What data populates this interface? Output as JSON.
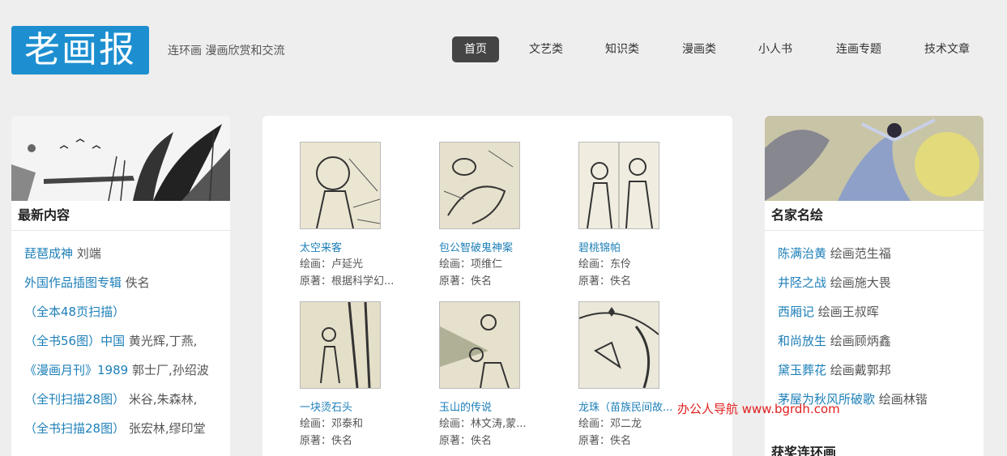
{
  "header": {
    "logo": "老画报",
    "tagline": "连环画 漫画欣赏和交流",
    "nav": [
      "首页",
      "文艺类",
      "知识类",
      "漫画类",
      "小人书",
      "连画专题",
      "技术文章"
    ],
    "active_nav": "首页"
  },
  "left": {
    "title": "最新内容",
    "items": [
      {
        "link": "琵琶成神",
        "text": " 刘端"
      },
      {
        "link": "外国作品插图专辑",
        "text": " 佚名"
      },
      {
        "link": "（全本48页扫描）",
        "text": ""
      },
      {
        "link": "（全书56图）中国",
        "text": " 黄光辉,丁燕,"
      },
      {
        "link": "《漫画月刊》1989",
        "text": " 郭士厂,孙绍波"
      },
      {
        "link": "（全刊扫描28图）",
        "text": " 米谷,朱森林,"
      },
      {
        "link": "（全书扫描28图）",
        "text": " 张宏林,缪印堂"
      }
    ]
  },
  "center": {
    "cards": [
      {
        "title": "太空来客",
        "artist": "绘画：卢延光",
        "origin": "原著：根据科学幻..."
      },
      {
        "title": "包公智破鬼神案",
        "artist": "绘画：项维仁",
        "origin": "原著：佚名"
      },
      {
        "title": "碧桃锦帕",
        "artist": "绘画：东伶",
        "origin": "原著：佚名"
      },
      {
        "title": "一块烫石头",
        "artist": "绘画：邓泰和",
        "origin": "原著：佚名"
      },
      {
        "title": "玉山的传说",
        "artist": "绘画：林文涛,蒙...",
        "origin": "原著：佚名"
      },
      {
        "title": "龙珠（苗族民间故...",
        "artist": "绘画：邓二龙",
        "origin": "原著：佚名"
      }
    ]
  },
  "right": {
    "title": "名家名绘",
    "items": [
      {
        "link": "陈满治黄",
        "text": " 绘画范生福"
      },
      {
        "link": "井陉之战",
        "text": " 绘画施大畏"
      },
      {
        "link": "西厢记",
        "text": " 绘画王叔晖"
      },
      {
        "link": "和尚放生",
        "text": " 绘画顾炳鑫"
      },
      {
        "link": "黛玉葬花",
        "text": " 绘画戴郭邦"
      },
      {
        "link": "茅屋为秋风所破歌",
        "text": " 绘画林锴"
      }
    ],
    "next_title": "获奖连环画"
  },
  "watermark": "办公人导航  www.bgrdh.com",
  "colors": {
    "brand": "#1d8fd0",
    "link": "#1d7fb8",
    "nav_active_bg": "#444444",
    "watermark": "#e02020"
  }
}
